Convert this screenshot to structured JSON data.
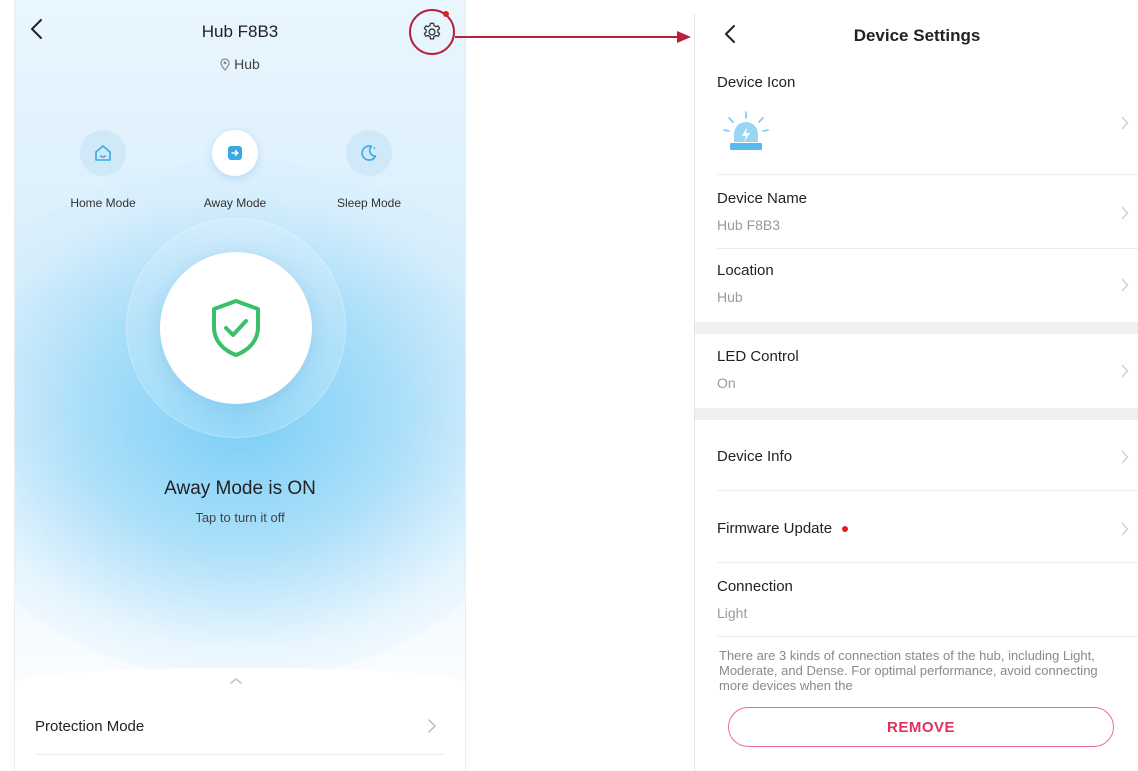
{
  "left_screen": {
    "title": "Hub F8B3",
    "location": "Hub",
    "modes": [
      {
        "label": "Home Mode",
        "icon": "home-icon",
        "active": false
      },
      {
        "label": "Away Mode",
        "icon": "away-icon",
        "active": true
      },
      {
        "label": "Sleep Mode",
        "icon": "moon-icon",
        "active": false
      }
    ],
    "status_title": "Away Mode is ON",
    "status_subtitle": "Tap to turn it off",
    "row_label": "Protection Mode",
    "notification_dot": true
  },
  "right_screen": {
    "title": "Device Settings",
    "device_icon_label": "Device Icon",
    "device_name_label": "Device Name",
    "device_name_value": "Hub F8B3",
    "location_label": "Location",
    "location_value": "Hub",
    "led_label": "LED Control",
    "led_value": "On",
    "device_info_label": "Device Info",
    "firmware_label": "Firmware Update",
    "connection_label": "Connection",
    "connection_value": "Light",
    "connection_note": "There are 3 kinds of connection states of the hub, including Light, Moderate, and Dense. For optimal performance, avoid connecting more devices when the",
    "remove_label": "REMOVE"
  },
  "colors": {
    "accent_blue": "#4fb8ef",
    "highlight_red": "#b8203b",
    "remove_pink": "#e0305e",
    "shield_green": "#3bbf6b"
  }
}
